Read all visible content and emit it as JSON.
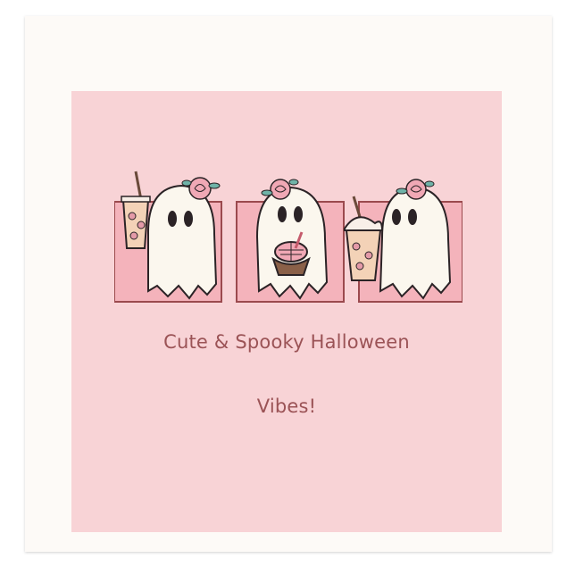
{
  "product": {
    "caption_line_1": "Cute & Spooky Halloween",
    "caption_line_2": "Vibes!"
  },
  "colors": {
    "napkin": "#fdfaf7",
    "print_background": "#f8d3d6",
    "panel_fill": "#f4b3bb",
    "panel_border": "#9b4a4e",
    "ghost_fill": "#fbf7ee",
    "ghost_outline": "#2b2326",
    "caption": "#9b5356"
  },
  "illustrations": [
    {
      "name": "ghost-with-iced-coffee",
      "accessory": "iced-coffee-cup-icon",
      "flower": "pink-rose-icon"
    },
    {
      "name": "ghost-with-pastry",
      "accessory": "concha-pastry-icon",
      "flower": "pink-rose-icon"
    },
    {
      "name": "ghost-with-frappe",
      "accessory": "whipped-frappe-cup-icon",
      "flower": "pink-rose-icon"
    }
  ]
}
